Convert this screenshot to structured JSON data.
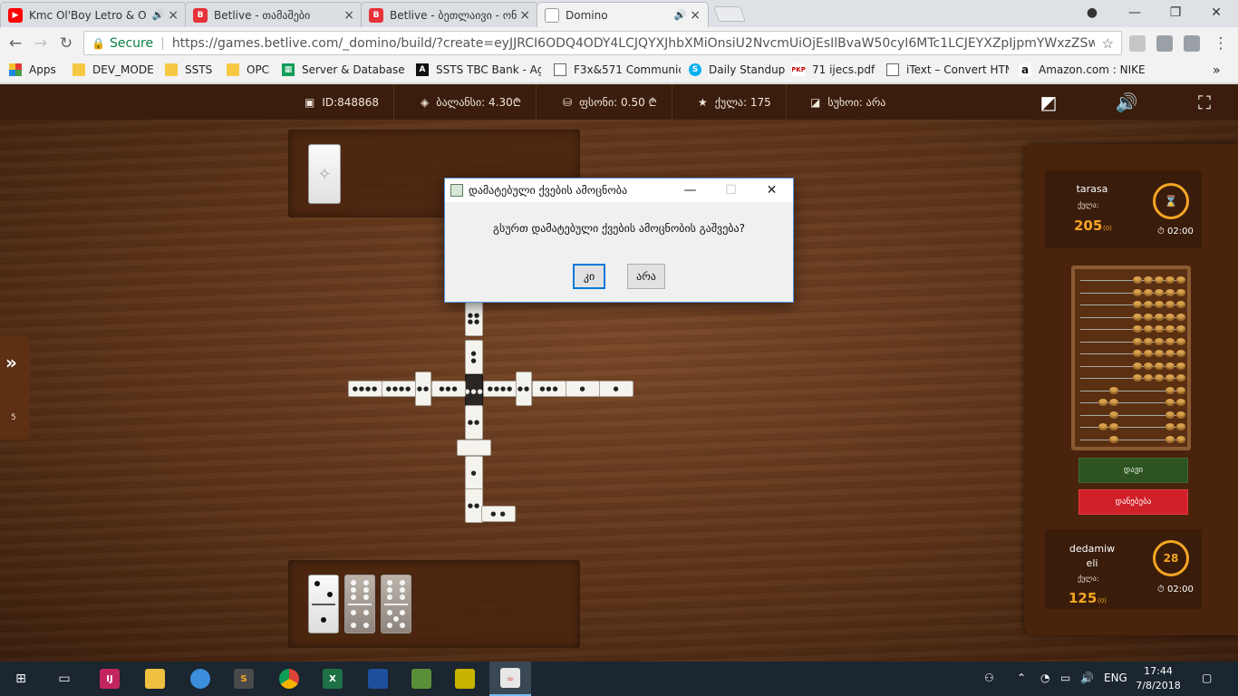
{
  "browser": {
    "tabs": [
      {
        "title": "Kmc Ol'Boy Letro & O",
        "favicon_color": "#ff0000",
        "favicon_text": "▶",
        "audio": true
      },
      {
        "title": "Betlive - თამაშები",
        "favicon_color": "#e53238",
        "favicon_text": "B",
        "audio": false
      },
      {
        "title": "Betlive - ბეთლაივი - ონ",
        "favicon_color": "#e53238",
        "favicon_text": "B",
        "audio": false
      },
      {
        "title": "Domino",
        "favicon_color": "#ffffff",
        "favicon_text": "",
        "audio": true
      }
    ],
    "omnibox": {
      "secure_label": "Secure",
      "url": "https://games.betlive.com/_domino/build/?create=eyJJRCI6ODQ4ODY4LCJQYXJhbXMiOnsiU2NvcmUiOjEsIlBvaW50cyI6MTc1LCJEYXZpIjpmYWxzZSwiU3V4b2kiOmZh..."
    },
    "bookmarks": [
      {
        "label": "Apps",
        "icon": "apps-icon"
      },
      {
        "label": "DEV_MODE",
        "icon": "folder-icon"
      },
      {
        "label": "SSTS",
        "icon": "folder-icon"
      },
      {
        "label": "OPC",
        "icon": "folder-icon"
      },
      {
        "label": "Server & Database P",
        "icon": "sheet-icon"
      },
      {
        "label": "SSTS TBC Bank - Ag",
        "icon": "bank-icon"
      },
      {
        "label": "F3x&571 Communic",
        "icon": "doc-icon"
      },
      {
        "label": "Daily Standup",
        "icon": "skype-icon"
      },
      {
        "label": "71 ijecs.pdf",
        "icon": "pdf-icon"
      },
      {
        "label": "iText – Convert HTM",
        "icon": "doc-icon"
      },
      {
        "label": "Amazon.com : NIKE",
        "icon": "amazon-icon"
      }
    ],
    "more_bookmarks": "»"
  },
  "game": {
    "stats": {
      "id": "ID:848868",
      "balance_label": "ბალანსი: 4.30₾",
      "price_label": "ფსონი: 0.50 ₾",
      "points_label": "ქულა: 175",
      "suxoi_label": "სუხოი: არა"
    },
    "side_tab_count": "5",
    "players": [
      {
        "name": "tarasa",
        "points_label": "ქულა:",
        "score": "205",
        "sub": "(0)",
        "ring": "⌛",
        "timer": "02:00"
      },
      {
        "name": "dedamiw eli",
        "points_label": "ქულა:",
        "score": "125",
        "sub": "(0)",
        "ring": "28",
        "timer": "02:00"
      }
    ],
    "buttons": {
      "pass": "დავი",
      "surrender": "დანებება"
    }
  },
  "dialog": {
    "title": "დამატებული ქვების ამოცნობა",
    "message": "გსურთ დამატებული ქვების ამოცნობის გაშვება?",
    "yes": "კი",
    "no": "არა"
  },
  "taskbar": {
    "lang": "ENG",
    "time": "17:44",
    "date": "7/8/2018"
  }
}
